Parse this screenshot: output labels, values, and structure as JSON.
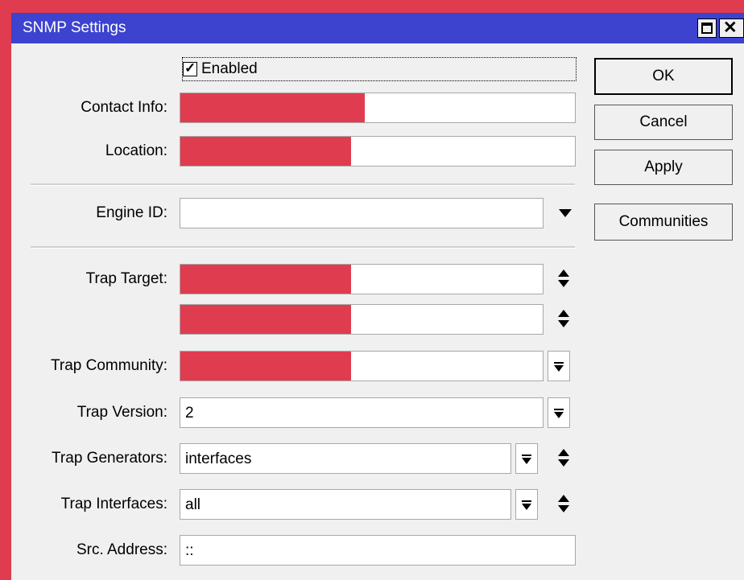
{
  "window": {
    "title": "SNMP Settings"
  },
  "form": {
    "enabled_label": "Enabled",
    "enabled_checked": true,
    "contact_info_label": "Contact Info:",
    "contact_info_value": "",
    "location_label": "Location:",
    "location_value": "",
    "engine_id_label": "Engine ID:",
    "engine_id_value": "",
    "trap_target_label": "Trap Target:",
    "trap_target_values": [
      "",
      ""
    ],
    "trap_community_label": "Trap Community:",
    "trap_community_value": "",
    "trap_version_label": "Trap Version:",
    "trap_version_value": "2",
    "trap_generators_label": "Trap Generators:",
    "trap_generators_value": "interfaces",
    "trap_interfaces_label": "Trap Interfaces:",
    "trap_interfaces_value": "all",
    "src_address_label": "Src. Address:",
    "src_address_value": "::"
  },
  "buttons": {
    "ok": "OK",
    "cancel": "Cancel",
    "apply": "Apply",
    "communities": "Communities"
  },
  "colors": {
    "titlebar": "#3d43cf",
    "redaction": "#e03c50",
    "background": "#f0f0f0"
  }
}
